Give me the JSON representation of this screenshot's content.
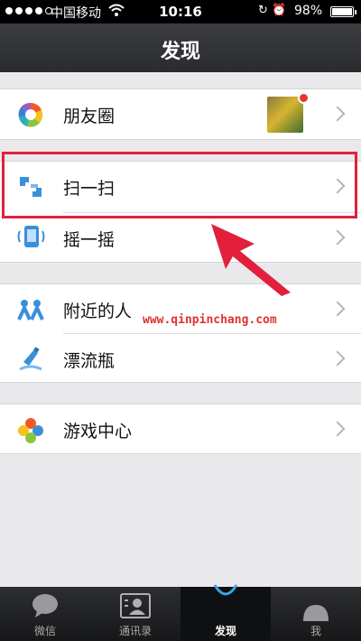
{
  "status_bar": {
    "carrier": "中国移动",
    "time": "10:16",
    "battery": "98%",
    "battery_level": 0.98
  },
  "nav": {
    "title": "发现"
  },
  "groups": [
    {
      "items": [
        {
          "label": "朋友圈",
          "icon": "moments-icon"
        }
      ]
    },
    {
      "items": [
        {
          "label": "扫一扫",
          "icon": "scan-icon"
        },
        {
          "label": "摇一摇",
          "icon": "shake-icon"
        }
      ]
    },
    {
      "items": [
        {
          "label": "附近的人",
          "icon": "nearby-people-icon"
        },
        {
          "label": "漂流瓶",
          "icon": "drift-bottle-icon"
        }
      ]
    },
    {
      "items": [
        {
          "label": "游戏中心",
          "icon": "game-center-icon"
        }
      ]
    }
  ],
  "watermark": "www.qinpinchang.com",
  "tabs": [
    {
      "label": "微信",
      "icon": "chat-bubble-icon",
      "active": false
    },
    {
      "label": "通讯录",
      "icon": "contacts-icon",
      "active": false
    },
    {
      "label": "发现",
      "icon": "discover-icon",
      "active": true
    },
    {
      "label": "我",
      "icon": "me-icon",
      "active": false
    }
  ],
  "colors": {
    "highlight": "#e2203b",
    "nav_background": "#2f3033",
    "badge": "#e5382c"
  }
}
